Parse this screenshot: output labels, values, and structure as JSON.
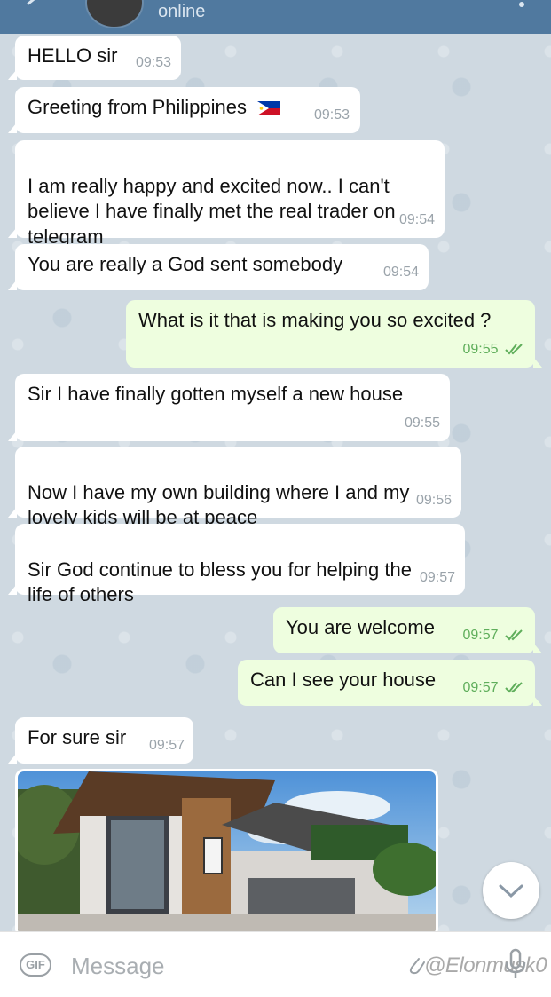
{
  "header": {
    "status": "online"
  },
  "messages": [
    {
      "text": "HELLO sir",
      "time": "09:53"
    },
    {
      "text": "Greeting from Philippines",
      "time": "09:53",
      "flag": "philippines-flag-icon"
    },
    {
      "text": "I am really happy and excited now.. I can't\nbelieve I have finally met the real trader on\ntelegram",
      "time": "09:54"
    },
    {
      "text": "You are really a God sent somebody",
      "time": "09:54"
    },
    {
      "text": "What is it that is making you so excited ?",
      "time": "09:55"
    },
    {
      "text": "Sir I have finally gotten myself a new house",
      "time": "09:55"
    },
    {
      "text": "Now I have my own building where I and my\nlovely kids will be at peace",
      "time": "09:56"
    },
    {
      "text": "Sir God continue to bless you for helping the\nlife of others",
      "time": "09:57"
    },
    {
      "text": "You are welcome",
      "time": "09:57"
    },
    {
      "text": "Can I see your house",
      "time": "09:57"
    },
    {
      "text": "For sure sir",
      "time": "09:57"
    }
  ],
  "photo": {
    "description_icon": "house-photo"
  },
  "input": {
    "placeholder": "Message",
    "gif_label": "GIF"
  },
  "watermark": "@Elonmusk0",
  "colors": {
    "header": "#50799f",
    "outgoing_bubble": "#eefedf",
    "incoming_bubble": "#ffffff",
    "tick": "#5fae5b"
  }
}
